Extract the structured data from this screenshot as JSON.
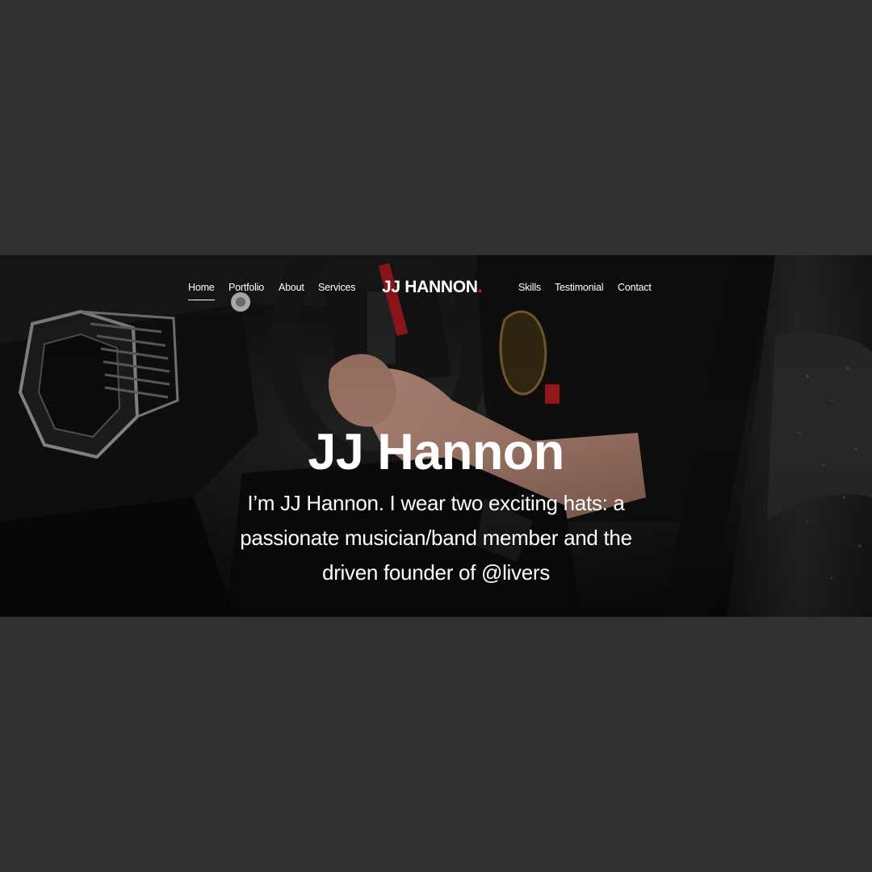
{
  "nav": {
    "left_items": [
      {
        "label": "Home"
      },
      {
        "label": "Portfolio"
      },
      {
        "label": "About"
      },
      {
        "label": "Services"
      }
    ],
    "right_items": [
      {
        "label": "Skills"
      },
      {
        "label": "Testimonial"
      },
      {
        "label": "Contact"
      }
    ],
    "active": "Home"
  },
  "brand": {
    "name": "JJ HANNON",
    "dot": ".",
    "dot_color": "#e3192d"
  },
  "hero": {
    "title": "JJ Hannon",
    "subtitle": "I’m JJ Hannon. I wear two exciting hats: a passionate musician/band member and the driven founder of @livers"
  },
  "colors": {
    "background": "#333030",
    "text": "#ffffff",
    "accent": "#e3192d"
  }
}
